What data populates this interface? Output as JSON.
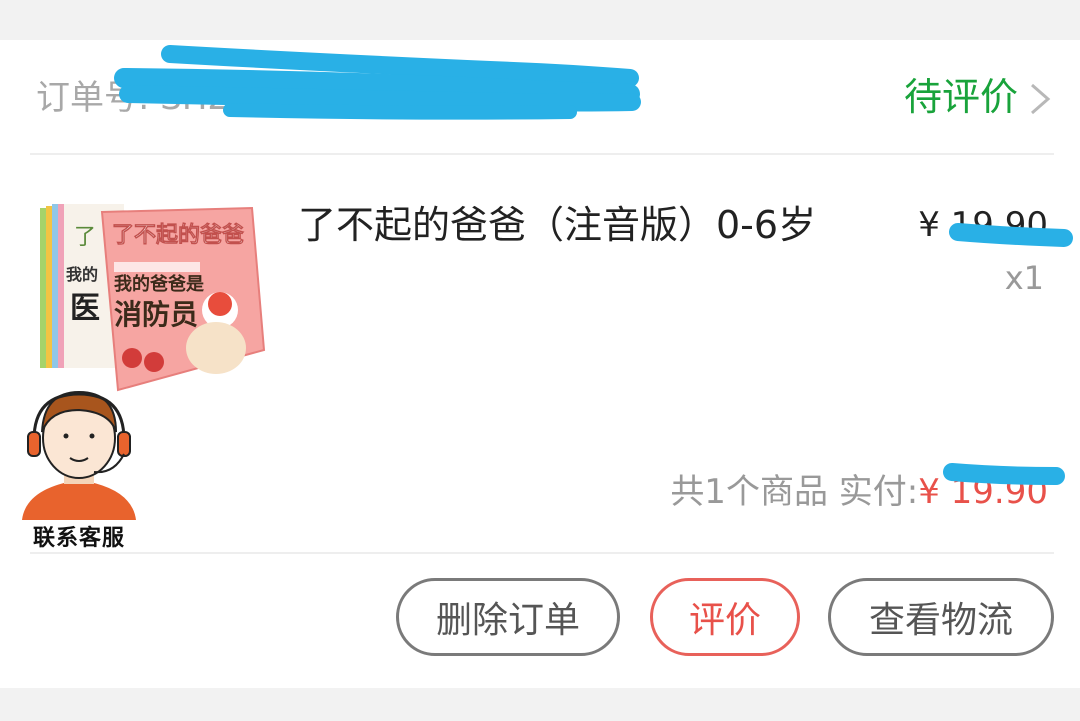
{
  "order": {
    "number_label": "订单号: SH20200002...",
    "status": "待评价"
  },
  "product": {
    "title": "了不起的爸爸（注音版）0-6岁",
    "price": "¥ 19.90",
    "quantity": "x1",
    "cover_text_top": "了不起的爸爸",
    "cover_text_main": "我的爸爸是",
    "cover_text_main2": "消防员",
    "cover_text_side": "医"
  },
  "summary": {
    "count_label": "共1个商品 实付:",
    "amount": "¥ 19.90"
  },
  "actions": {
    "delete": "删除订单",
    "rate": "评价",
    "logistics": "查看物流"
  },
  "support": {
    "label": "联系客服"
  },
  "colors": {
    "status_green": "#19a33b",
    "accent_red": "#e8514a",
    "scribble_blue": "#29b0e6"
  }
}
